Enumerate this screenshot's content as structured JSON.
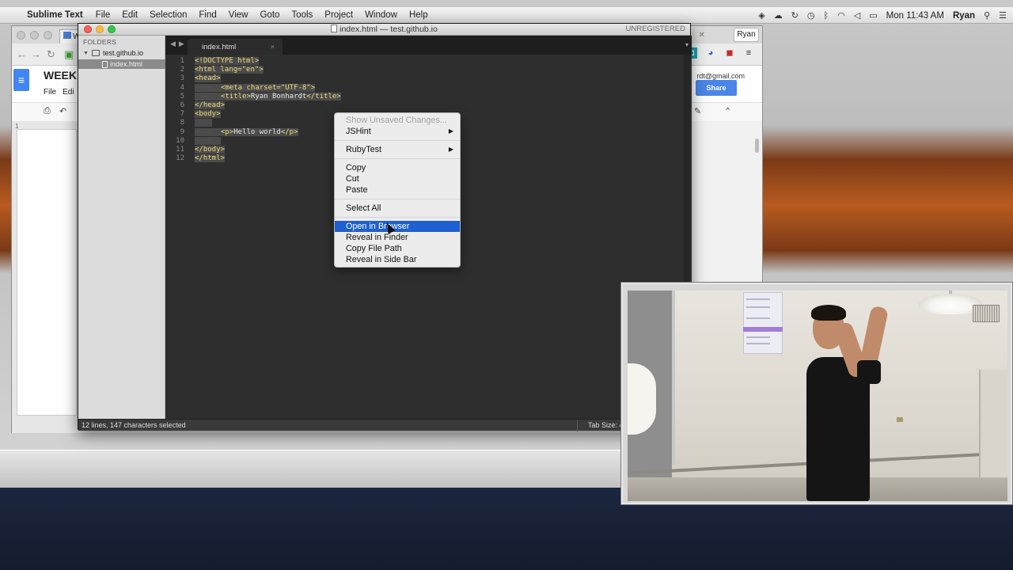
{
  "menubar": {
    "apple_glyph": "",
    "app_name": "Sublime Text",
    "items": [
      "File",
      "Edit",
      "Selection",
      "Find",
      "View",
      "Goto",
      "Tools",
      "Project",
      "Window",
      "Help"
    ],
    "clock": "Mon 11:43 AM",
    "user": "Ryan"
  },
  "chrome": {
    "tab_label": "W",
    "user_chip": "Ryan",
    "docs": {
      "title": "WEEK",
      "menu": [
        "File",
        "Edi"
      ],
      "email": "rdt@gmail.com",
      "share_label": "Share",
      "ruler_number": "1"
    }
  },
  "sublime": {
    "window_title": "index.html — test.github.io",
    "unregistered": "UNREGISTERED",
    "sidebar": {
      "folders_label": "FOLDERS",
      "folder_name": "test.github.io",
      "file_name": "index.html"
    },
    "tab": {
      "label": "index.html",
      "close": "×"
    },
    "tab_dropdown": "▾",
    "line_numbers": [
      "1",
      "2",
      "3",
      "4",
      "5",
      "6",
      "7",
      "8",
      "9",
      "10",
      "11",
      "12"
    ],
    "code": {
      "l1": "<!DOCTYPE html>",
      "l2": "<html lang=\"en\">",
      "l3": "<head>",
      "l4": "<meta charset=\"UTF-8\">",
      "l5_open": "<title>",
      "l5_text": "Ryan Bonhardt",
      "l5_close": "</title>",
      "l6": "</head>",
      "l7": "<body>",
      "l9_open": "<p>",
      "l9_text": "Hello world",
      "l9_close": "</p>",
      "l11": "</body>",
      "l12": "</html>"
    },
    "status_left": "12 lines, 147 characters selected",
    "status_right": "Tab Size: 4"
  },
  "context_menu": {
    "items": [
      {
        "label": "Show Unsaved Changes...",
        "disabled": true
      },
      {
        "label": "JSHint",
        "submenu": true
      },
      {
        "label": "RubyTest",
        "submenu": true
      },
      {
        "label": "Copy"
      },
      {
        "label": "Cut"
      },
      {
        "label": "Paste"
      },
      {
        "label": "Select All"
      },
      {
        "label": "Open in Browser",
        "highlighted": true
      },
      {
        "label": "Reveal in Finder"
      },
      {
        "label": "Copy File Path"
      },
      {
        "label": "Reveal in Side Bar"
      }
    ],
    "submenu_arrow": "▶"
  },
  "colors": {
    "menu_highlight": "#1d60d0",
    "code_tag": "#f1dc7e",
    "editor_bg": "#2e2e2e",
    "share_button": "#4a86e8"
  }
}
